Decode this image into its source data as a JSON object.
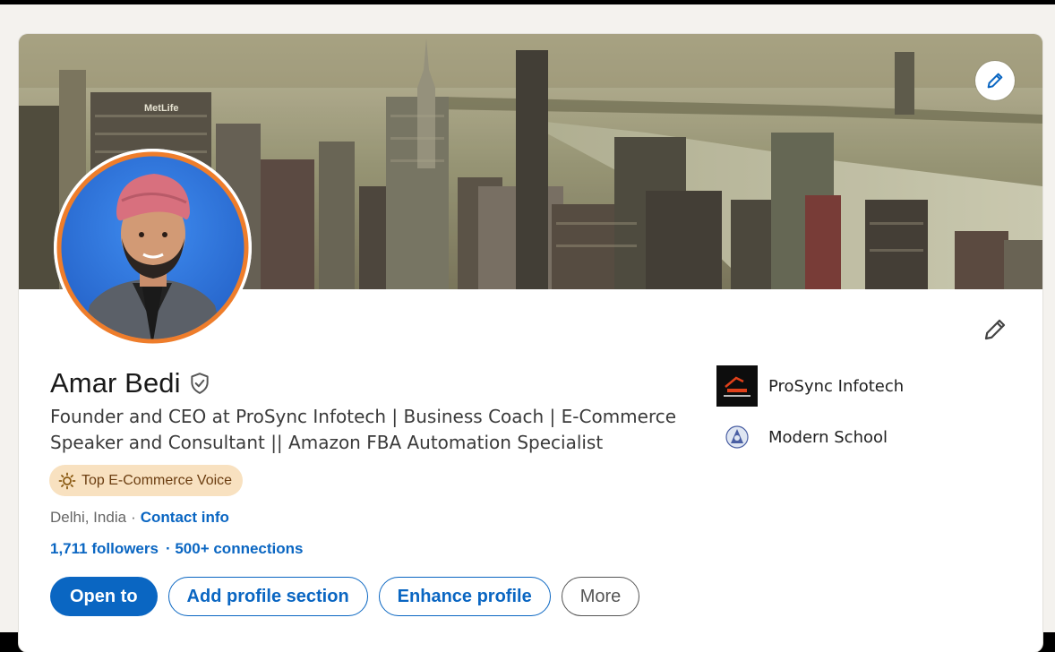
{
  "profile": {
    "name": "Amar Bedi",
    "headline_line1": "Founder and CEO at ProSync Infotech | Business Coach | E-Commerce",
    "headline_line2": "Speaker and Consultant || Amazon FBA Automation Specialist",
    "badge": "Top E-Commerce Voice",
    "location": "Delhi, India",
    "separator": "·",
    "contact_info": "Contact info",
    "followers": "1,711 followers",
    "connections": "· 500+ connections"
  },
  "organizations": [
    {
      "name": "ProSync Infotech",
      "logo": "prosync-logo"
    },
    {
      "name": "Modern School",
      "logo": "modern-school-logo"
    }
  ],
  "actions": {
    "open_to": "Open to",
    "add_section": "Add profile section",
    "enhance": "Enhance profile",
    "more": "More"
  },
  "banner": {
    "sign_text": "MetLife"
  },
  "icons": {
    "verified": "shield-check-icon",
    "banner_edit": "pencil-icon",
    "intro_edit": "pencil-icon",
    "badge": "sun-icon"
  },
  "colors": {
    "accent": "#0a66c2",
    "badge_bg": "#f8e1c0",
    "avatar_ring": "#ee7d2b"
  }
}
